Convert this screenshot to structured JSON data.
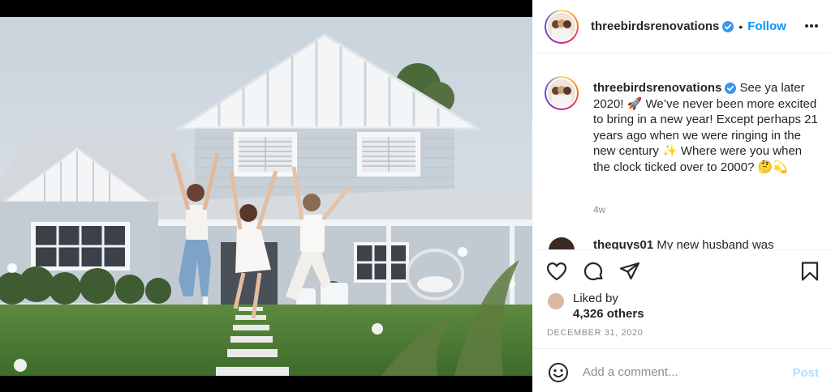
{
  "header": {
    "username": "threebirdsrenovations",
    "separator": "•",
    "follow_label": "Follow"
  },
  "caption": {
    "username": "threebirdsrenovations",
    "text": "See ya later 2020! 🚀 We’ve never been more excited to bring in a new year! Except perhaps 21 years ago when we were ringing in the new century ✨ Where were you when the clock ticked over to 2000? 🤔💫",
    "time": "4w"
  },
  "comment_preview": {
    "username": "theguys01",
    "text": "My new husband was"
  },
  "likes": {
    "prefix": "Liked by",
    "count": "4,326 others"
  },
  "date": "DECEMBER 31, 2020",
  "add_comment": {
    "placeholder": "Add a comment...",
    "post_label": "Post"
  },
  "icons": {
    "like": "heart-icon",
    "comment": "comment-icon",
    "share": "share-icon",
    "save": "bookmark-icon",
    "emoji": "emoji-icon",
    "more": "more-options-icon",
    "verified": "verified-badge-icon"
  },
  "colors": {
    "link": "#0095f6",
    "post_disabled": "#b2dffc",
    "muted": "#8e8e8e",
    "verified": "#3897f0"
  }
}
